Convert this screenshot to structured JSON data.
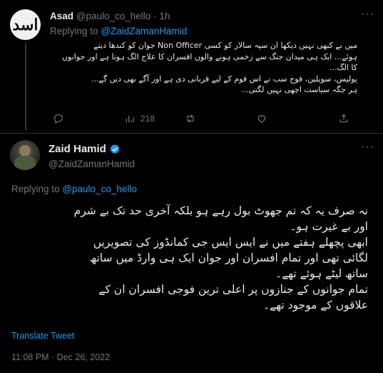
{
  "reply": {
    "avatar_glyph": "اسد",
    "name": "Asad",
    "handle": "@paulo_co_hello",
    "separator": "·",
    "time": "1h",
    "replying_prefix": "Replying to",
    "replying_handle": "@ZaidZamanHamid",
    "text_lines": [
      "میں نے کبھی نہیں دیکھا ان سپہ سالار کو کسی Non Officer جوان کو کندھا دیتے",
      "ہوئے... ایک ہی میدان جنگ سے زخمی ہونے والوں افسران کا علاج الگ ہوتا ہے اور جوانوں",
      "کا الگ...",
      "پولیس، سویلین، فوج سب نے اس قوم کے لیے قربانی دی ہے اور آگے بھی دیں گے...",
      "ہر جگہ سیاست اچھی نہیں لگتی..."
    ],
    "actions": {
      "reply": "",
      "retweet": "",
      "like": "",
      "views": "218",
      "share": ""
    }
  },
  "tweet": {
    "name": "Zaid Hamid",
    "verified": "verified-badge-icon",
    "handle": "@ZaidZamanHamid",
    "replying_prefix": "Replying to",
    "replying_handle": "@paulo_co_hello",
    "text_lines": [
      "نہ صرف یہ کہ تم جھوٹ بول رہے ہو بلکہ آخری حد تک بے شرم",
      "اور بے غیرت ہو۔",
      "ابھی پچھلے ہفتے میں نے ایس ایس جی کمانڈوز کی تصویریں",
      "لگائی تھی اور تمام افسران اور جوان ایک ہی وارڈ میں ساتھ",
      "ساتھ لیٹے ہوئے تھے۔",
      "تمام جوانوں کے جنازوں پر اعلی ترین فوجی افسران ان کے",
      "علاقوں کے موجود تھے۔"
    ],
    "translate": "Translate Tweet",
    "timestamp": "11:08 PM · Dec 26, 2022"
  },
  "colors": {
    "background": "#000000",
    "text": "#e7e9ea",
    "muted": "#71767b",
    "link": "#1d9bf0",
    "divider": "#2f3336"
  }
}
